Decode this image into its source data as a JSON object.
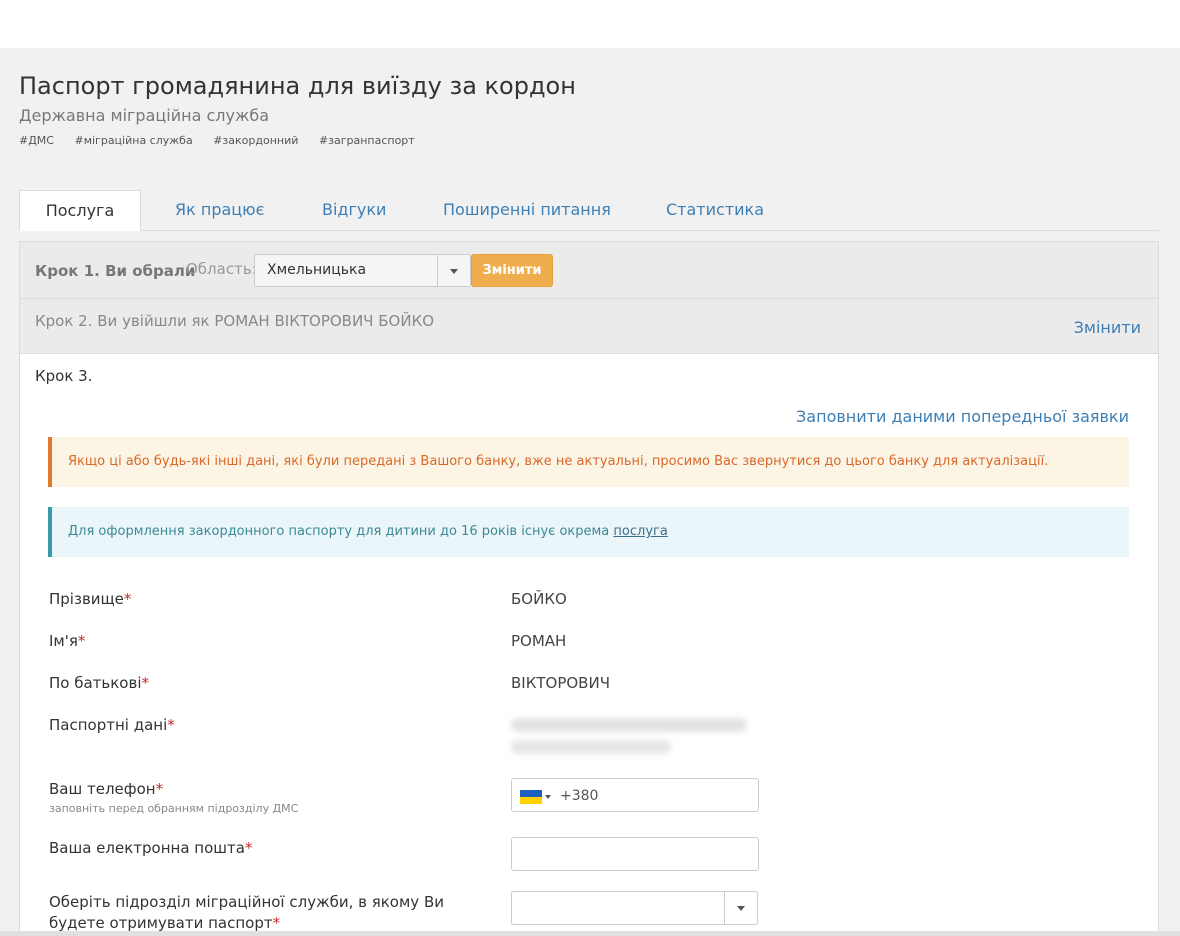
{
  "page": {
    "title": "Паспорт громадянина для виїзду за кордон",
    "subtitle": "Державна міграційна служба",
    "tags": [
      "#ДМС",
      "#міграційна служба",
      "#закордонний",
      "#загранпаспорт"
    ]
  },
  "tabs": [
    {
      "label": "Послуга",
      "active": true
    },
    {
      "label": "Як працює",
      "active": false
    },
    {
      "label": "Відгуки",
      "active": false
    },
    {
      "label": "Поширенні питання",
      "active": false
    },
    {
      "label": "Статистика",
      "active": false
    }
  ],
  "step1": {
    "label": "Крок 1. Ви обрали",
    "region_label": "Область:",
    "region_value": "Хмельницька",
    "change_button": "Змінити"
  },
  "step2": {
    "label": "Крок 2. Ви увійшли як РОМАН ВІКТОРОВИЧ БОЙКО",
    "change_link": "Змінити"
  },
  "step3": {
    "label": "Крок 3.",
    "fill_previous_link": "Заповнити даними попередньої заявки",
    "warning_text": "Якщо ці або будь-які інші дані, які були передані з Вашого банку, вже не актуальні, просимо Вас звернутися до цього банку для актуалізації.",
    "info_text": "Для оформлення закордонного паспорту для дитини до 16 років існує окрема ",
    "info_link": "послуга"
  },
  "form": {
    "required_mark": "*",
    "surname_label": "Прізвище",
    "surname_value": "БОЙКО",
    "name_label": "Ім'я",
    "name_value": "РОМАН",
    "patronymic_label": "По батькові",
    "patronymic_value": "ВІКТОРОВИЧ",
    "passport_label": "Паспортні дані",
    "phone_label": "Ваш телефон",
    "phone_hint": "заповніть перед обранням підрозділу ДМС",
    "phone_code": "+380",
    "email_label": "Ваша електронна пошта",
    "email_value": "",
    "unit_label_line1": "Оберіть підрозділ міграційної служби, в якому Ви",
    "unit_label_line2": "будете отримувати паспорт",
    "unit_value": ""
  },
  "colors": {
    "link": "#3d7fb5",
    "warning_border": "#e07b2d",
    "info_border": "#3a9aa8",
    "button": "#f0ad4e",
    "required": "#c62828"
  }
}
